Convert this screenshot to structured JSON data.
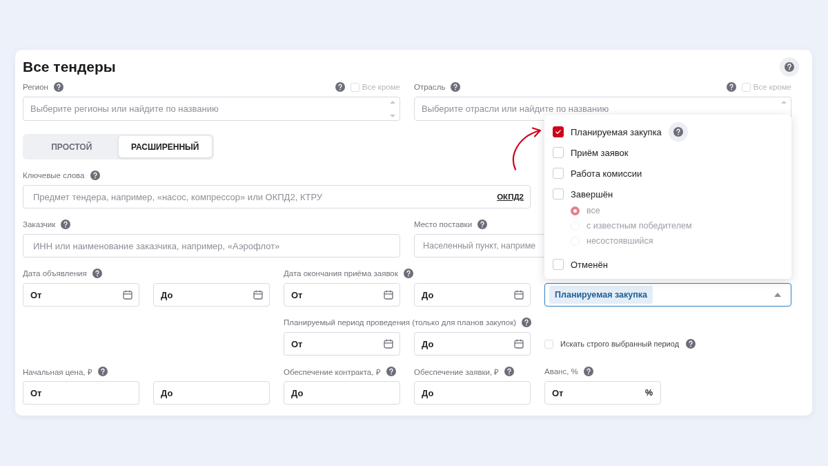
{
  "title": "Все тендеры",
  "region": {
    "label": "Регион",
    "placeholder": "Выберите регионы или найдите по названию",
    "except_label": "Все кроме",
    "except_checked": false
  },
  "industry": {
    "label": "Отрасль",
    "placeholder": "Выберите отрасли или найдите по названию",
    "except_label": "Все кроме",
    "except_checked": false
  },
  "mode_tabs": [
    {
      "label": "ПРОСТОЙ",
      "selected": false
    },
    {
      "label": "РАСШИРЕННЫЙ",
      "selected": true
    }
  ],
  "keywords": {
    "label": "Ключевые слова",
    "placeholder": "Предмет тендера, например, «насос, компрессор» или ОКПД2, КТРУ",
    "link": "ОКПД2"
  },
  "customer": {
    "label": "Заказчик",
    "placeholder": "ИНН или наименование заказчика, например, «Аэрофлот»"
  },
  "delivery": {
    "label": "Место поставки",
    "placeholder": "Населенный пункт, наприме"
  },
  "announce_date": {
    "label": "Дата объявления",
    "inputs": [
      {
        "placeholder": "От"
      },
      {
        "placeholder": "До"
      }
    ]
  },
  "deadline_date": {
    "label": "Дата окончания приёма заявок",
    "inputs": [
      {
        "placeholder": "От"
      },
      {
        "placeholder": "До"
      }
    ]
  },
  "stage": {
    "chips": [
      "Планируемая закупка"
    ],
    "expanded": true,
    "options": [
      {
        "label": "Планируемая закупка",
        "checked": true,
        "help": true
      },
      {
        "label": "Приём заявок",
        "checked": false,
        "help": false
      },
      {
        "label": "Работа комиссии",
        "checked": false,
        "help": false
      },
      {
        "label": "Завершён",
        "checked": false,
        "help": false,
        "children": [
          {
            "label": "все",
            "selected": true,
            "disabled": true
          },
          {
            "label": "с известным победителем",
            "selected": false,
            "disabled": true
          },
          {
            "label": "несостоявшийся",
            "selected": false,
            "disabled": true
          }
        ]
      },
      {
        "label": "Отменён",
        "checked": false,
        "help": false
      }
    ]
  },
  "planned_period": {
    "label": "Планируемый период проведения (только для планов закупок)",
    "inputs": [
      {
        "placeholder": "От"
      },
      {
        "placeholder": "До"
      }
    ]
  },
  "strict_period": {
    "label": "Искать строго выбранный период",
    "checked": false
  },
  "start_price": {
    "label": "Начальная цена, ₽",
    "inputs": [
      {
        "placeholder": "От"
      },
      {
        "placeholder": "До"
      }
    ]
  },
  "contract_security": {
    "label": "Обеспечение контракта, ₽",
    "placeholder": "До"
  },
  "bid_security": {
    "label": "Обеспечение заявки, ₽",
    "placeholder": "До"
  },
  "advance": {
    "label": "Аванс, %",
    "placeholder": "От",
    "suffix": "%"
  }
}
